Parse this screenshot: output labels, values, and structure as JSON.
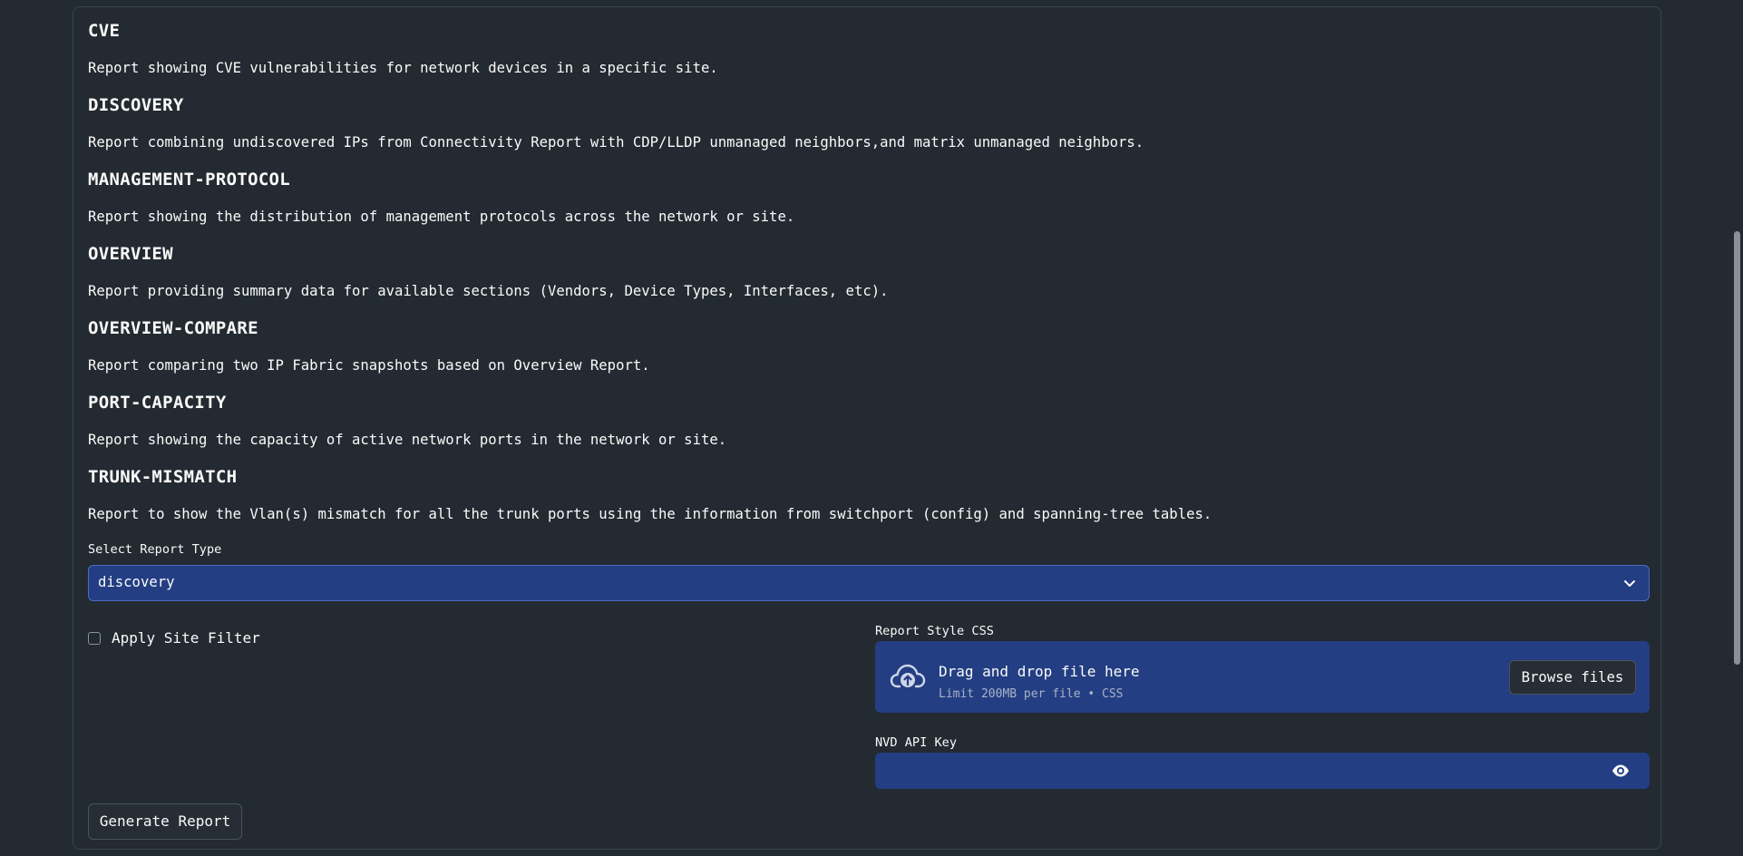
{
  "reports": [
    {
      "name": "CVE",
      "description": "Report showing CVE vulnerabilities for network devices in a specific site."
    },
    {
      "name": "DISCOVERY",
      "description": "Report combining undiscovered IPs from Connectivity Report with CDP/LLDP unmanaged neighbors,and matrix unmanaged neighbors."
    },
    {
      "name": "MANAGEMENT-PROTOCOL",
      "description": "Report showing the distribution of management protocols across the network or site."
    },
    {
      "name": "OVERVIEW",
      "description": "Report providing summary data for available sections (Vendors, Device Types, Interfaces, etc)."
    },
    {
      "name": "OVERVIEW-COMPARE",
      "description": "Report comparing two IP Fabric snapshots based on Overview Report."
    },
    {
      "name": "PORT-CAPACITY",
      "description": "Report showing the capacity of active network ports in the network or site."
    },
    {
      "name": "TRUNK-MISMATCH",
      "description": "Report to show the Vlan(s) mismatch for all the trunk ports using the information from switchport (config) and spanning-tree tables."
    }
  ],
  "report_type": {
    "label": "Select Report Type",
    "selected": "discovery"
  },
  "site_filter": {
    "label": "Apply Site Filter",
    "checked": false
  },
  "css_upload": {
    "label": "Report Style CSS",
    "drop_text": "Drag and drop file here",
    "limit_text": "Limit 200MB per file • CSS",
    "browse_label": "Browse files"
  },
  "nvd_key": {
    "label": "NVD API Key",
    "value": ""
  },
  "generate_label": "Generate Report",
  "colors": {
    "background": "#232a31",
    "accent_blue": "#233e82",
    "text": "#fafafa"
  }
}
